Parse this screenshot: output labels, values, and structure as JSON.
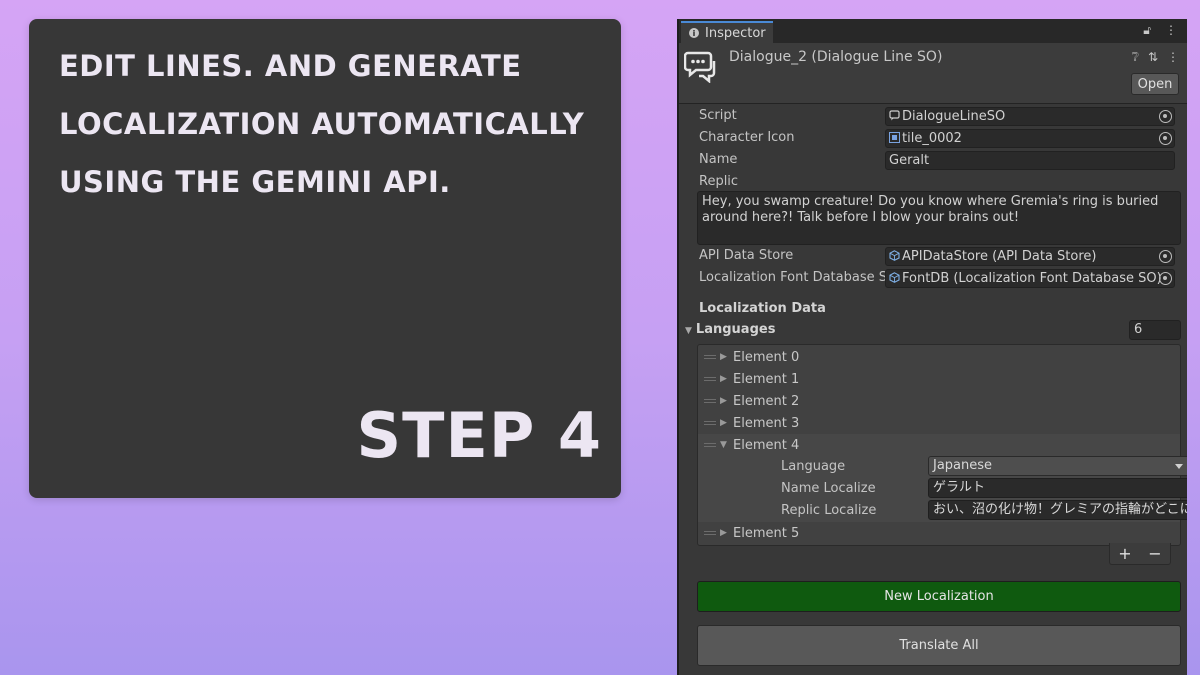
{
  "promo": {
    "lines": [
      "EDIT LINES. AND GENERATE",
      "LOCALIZATION AUTOMATICALLY",
      "USING THE GEMINI API."
    ],
    "step": "STEP 4"
  },
  "inspector": {
    "tab_label": "Inspector",
    "tab_icons": [
      "lock-icon",
      "kebab-menu-icon"
    ],
    "object_title": "Dialogue_2 (Dialogue Line SO)",
    "header_icons": [
      "help-icon",
      "settings-icon",
      "kebab-menu-icon"
    ],
    "open_label": "Open",
    "fields": [
      {
        "label": "Script",
        "value": "DialogueLineSO",
        "icon": "script-icon"
      },
      {
        "label": "Character Icon",
        "value": "tile_0002",
        "icon": "sprite-icon"
      },
      {
        "label": "Name",
        "value": "Geralt"
      },
      {
        "label": "Replic"
      }
    ],
    "replic_text": "Hey, you swamp creature! Do you know where Gremia's ring is buried around here?! Talk before I blow your brains out!",
    "refs": [
      {
        "label": "API Data Store",
        "value": "APIDataStore (API Data Store)",
        "icon": "scriptable-object-icon"
      },
      {
        "label": "Localization Font Database S",
        "value": "FontDB (Localization Font Database SO)",
        "icon": "scriptable-object-icon"
      }
    ],
    "localization_title": "Localization Data",
    "languages_label": "Languages",
    "languages_count": "6",
    "elements": [
      "Element 0",
      "Element 1",
      "Element 2",
      "Element 3",
      "Element 4",
      "Element 5"
    ],
    "expanded": {
      "language_label": "Language",
      "language_value": "Japanese",
      "name_label": "Name Localize",
      "name_value": "ゲラルト",
      "replic_label": "Replic Localize",
      "replic_value": "おい、沼の化け物！グレミアの指輪がどこに"
    },
    "plus": "+",
    "minus": "−",
    "new_localization": "New Localization",
    "translate_all": "Translate All"
  },
  "colors": {
    "background_top": "#d5a4f5",
    "background_bottom": "#a995ee",
    "card": "#373737",
    "inspector_bg": "#383838",
    "new_button_green": "#0f5a0f"
  }
}
